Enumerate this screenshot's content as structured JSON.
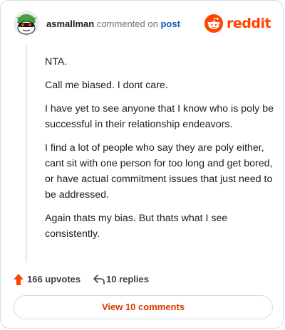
{
  "comment": {
    "username": "asmallman",
    "verb": "commented on",
    "target": "post",
    "paragraphs": [
      "NTA.",
      "Call me biased. I dont care.",
      "I have yet to see anyone that I know who is poly be successful in their relationship endeavors.",
      "I find a lot of people who say they are poly either, cant sit with one person for too long and get bored, or have actual commitment issues that just need to be addressed.",
      "Again thats my bias. But thats what I see consistently."
    ],
    "upvotes": "166 upvotes",
    "replies": "10 replies"
  },
  "brand": {
    "wordmark": "reddit",
    "color": "#ff4500"
  },
  "footer": {
    "view_label": "View 10 comments"
  },
  "icons": {
    "avatar": "snoo-avatar",
    "brand": "reddit-logo-icon",
    "upvote": "upvote-arrow-icon",
    "reply": "reply-arrow-icon"
  },
  "colors": {
    "link": "#0a5cc2",
    "button_text": "#d93a00",
    "upvote": "#ff4500"
  }
}
